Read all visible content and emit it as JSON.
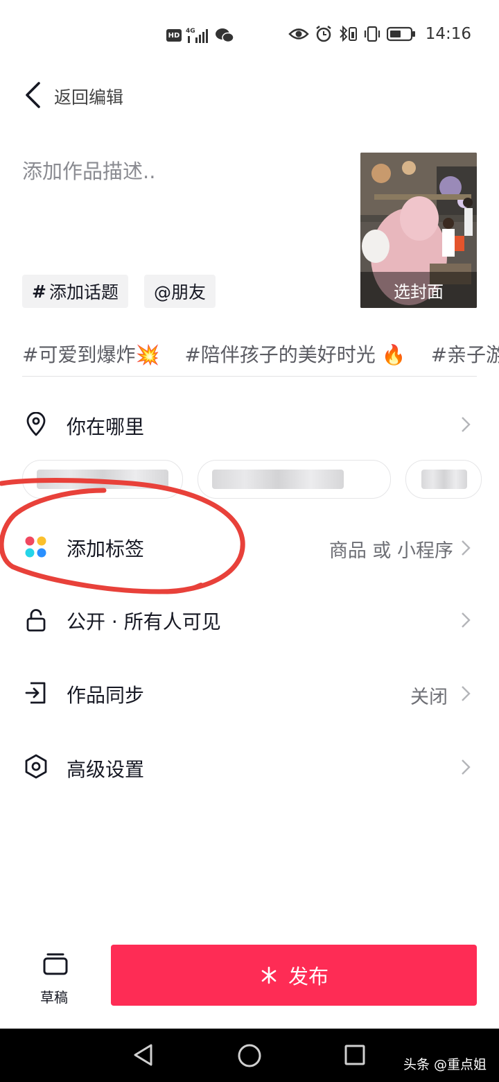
{
  "status_bar": {
    "hd": "HD",
    "network": "4G",
    "time": "14:16"
  },
  "header": {
    "back_label": "返回编辑"
  },
  "description": {
    "placeholder": "添加作品描述..",
    "cover_label": "选封面"
  },
  "pills": {
    "topic": "添加话题",
    "topic_symbol": "#",
    "friend": "@朋友"
  },
  "suggested_tags": [
    "#可爱到爆炸💥",
    "#陪伴孩子的美好时光 🔥",
    "#亲子游"
  ],
  "rows": {
    "location": {
      "label": "你在哪里"
    },
    "add_tag": {
      "label": "添加标签",
      "value": "商品 或 小程序"
    },
    "visibility": {
      "label": "公开 · 所有人可见"
    },
    "sync": {
      "label": "作品同步",
      "value": "关闭"
    },
    "advanced": {
      "label": "高级设置"
    }
  },
  "bottom": {
    "draft_label": "草稿",
    "publish_label": "发布"
  },
  "watermark": "头条 @重点姐",
  "colors": {
    "accent": "#fe2c55",
    "annotation": "#e8413a"
  }
}
